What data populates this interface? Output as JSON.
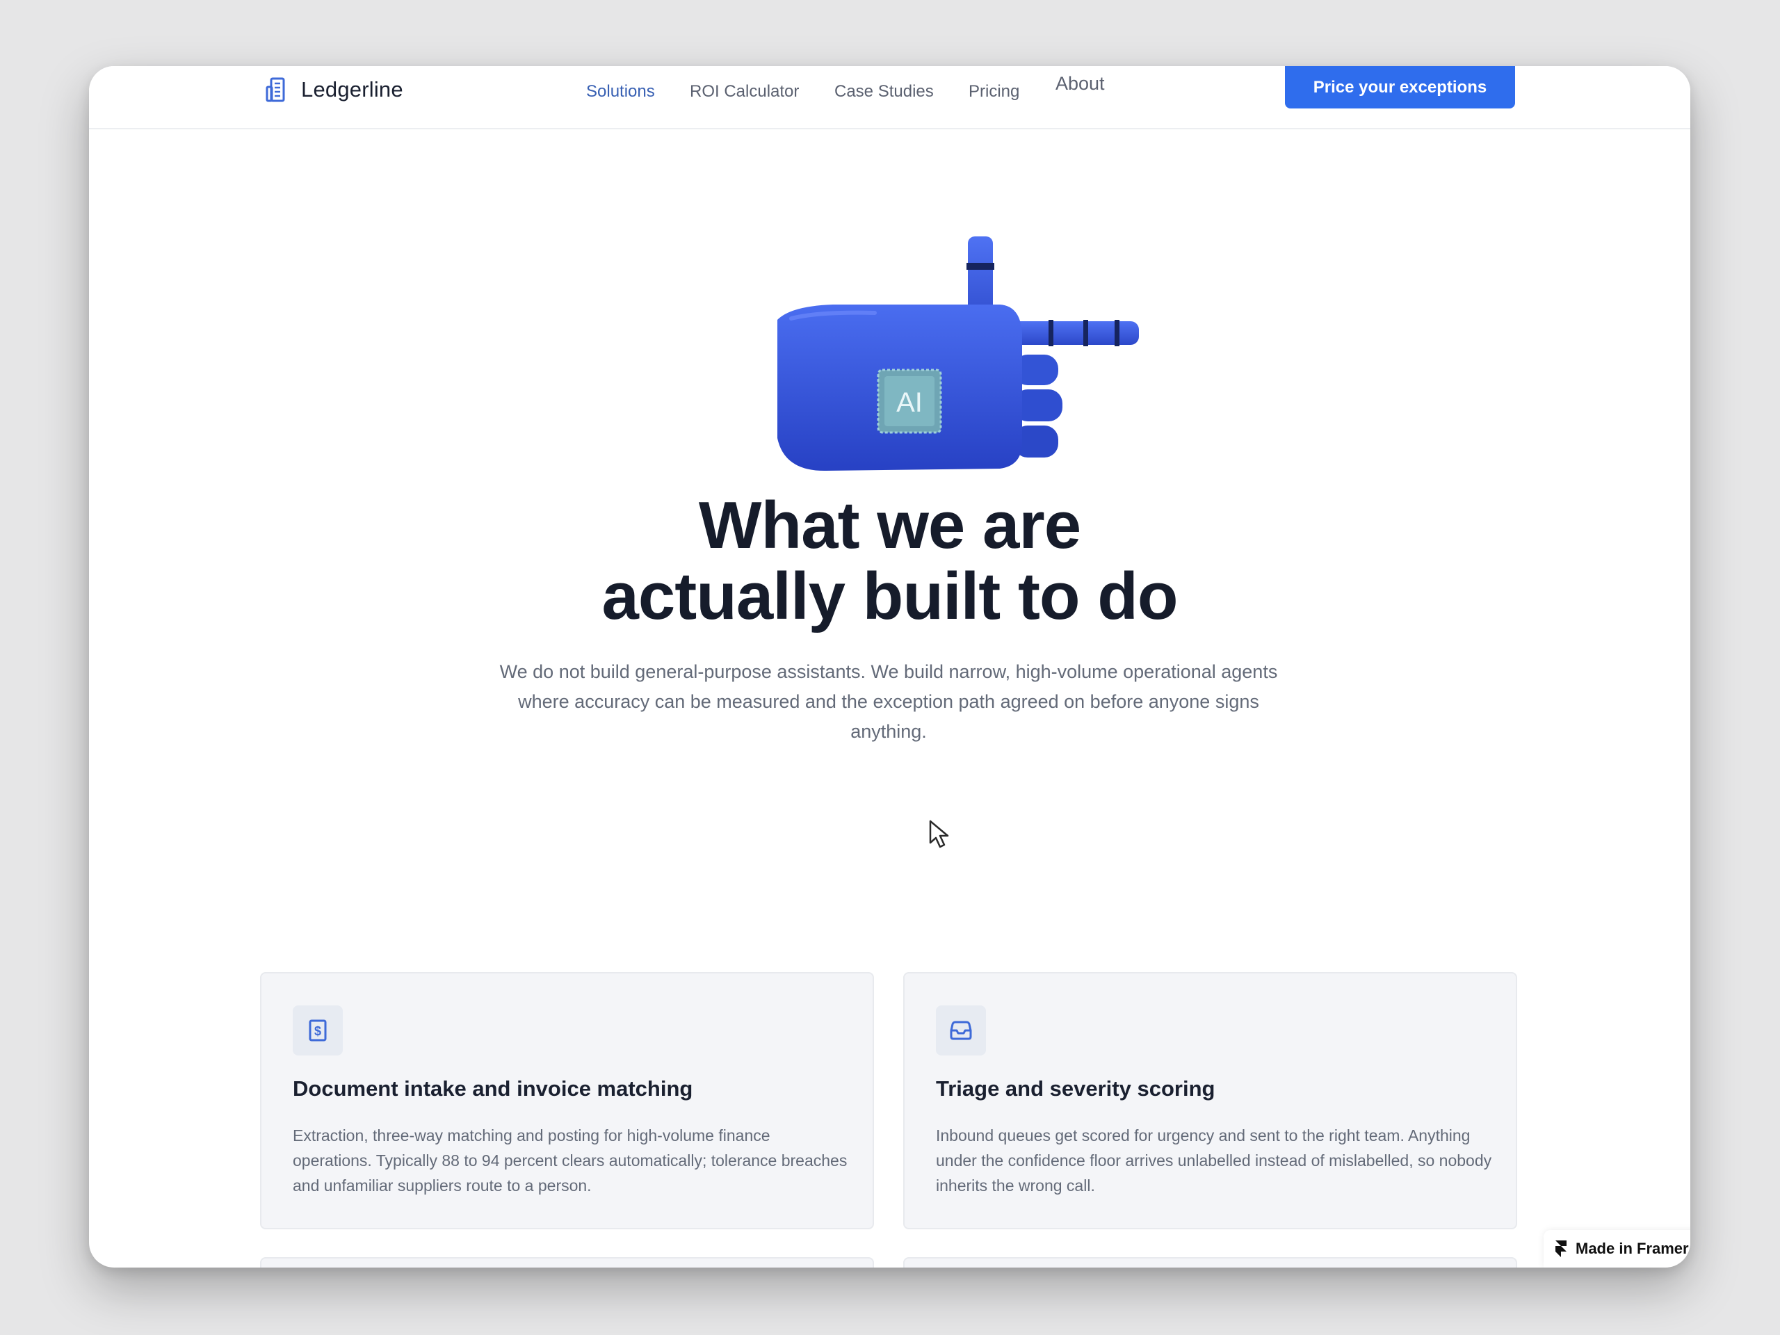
{
  "brand": {
    "name": "Ledgerline",
    "icon": "building-icon"
  },
  "nav": {
    "items": [
      {
        "label": "Solutions",
        "active": true
      },
      {
        "label": "ROI Calculator",
        "active": false
      },
      {
        "label": "Case Studies",
        "active": false
      },
      {
        "label": "Pricing",
        "active": false
      },
      {
        "label": "About",
        "active": false
      }
    ],
    "cta_label": "Price your exceptions"
  },
  "hero": {
    "chip_label": "AI",
    "headline_line1": "What we are",
    "headline_line2": "actually built to do",
    "subtext": "We do not build general-purpose assistants. We build narrow, high-volume operational agents where accuracy can be measured and the exception path agreed on before anyone signs anything."
  },
  "cards": [
    {
      "icon": "invoice-dollar-icon",
      "title": "Document intake and invoice matching",
      "body": "Extraction, three-way matching and posting for high-volume finance operations. Typically 88 to 94 percent clears automatically; tolerance breaches and unfamiliar suppliers route to a person."
    },
    {
      "icon": "inbox-icon",
      "title": "Triage and severity scoring",
      "body": "Inbound queues get scored for urgency and sent to the right team. Anything under the confidence floor arrives unlabelled instead of mislabelled, so nobody inherits the wrong call."
    }
  ],
  "badge": {
    "label": "Made in Framer"
  },
  "colors": {
    "accent": "#2f6ded",
    "nav_active": "#3860b3",
    "heading": "#161c2b",
    "body_text": "#636a78",
    "card_bg": "#f4f5f8",
    "robot_hand": "#3352d8"
  }
}
